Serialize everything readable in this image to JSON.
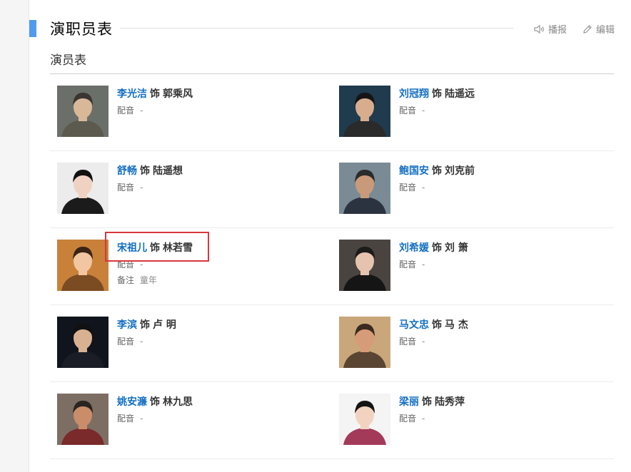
{
  "section": {
    "title": "演职员表",
    "tools": {
      "report": "播报",
      "edit": "编辑"
    }
  },
  "subheading": "演员表",
  "role_joiner": "饰",
  "dub_label": "配音",
  "note_label": "备注",
  "cast": [
    {
      "actor": "李光洁",
      "role": "郭乘风",
      "dub": "-",
      "note": null
    },
    {
      "actor": "刘冠翔",
      "role": "陆遥远",
      "dub": "-",
      "note": null
    },
    {
      "actor": "舒畅",
      "role": "陆遥想",
      "dub": "-",
      "note": null
    },
    {
      "actor": "鲍国安",
      "role": "刘克前",
      "dub": "-",
      "note": null
    },
    {
      "actor": "宋祖儿",
      "role": "林若雪",
      "dub": "-",
      "note": "童年"
    },
    {
      "actor": "刘希媛",
      "role": "刘 箫",
      "dub": "-",
      "note": null
    },
    {
      "actor": "李滨",
      "role": "卢 明",
      "dub": "-",
      "note": null
    },
    {
      "actor": "马文忠",
      "role": "马 杰",
      "dub": "-",
      "note": null
    },
    {
      "actor": "姚安濂",
      "role": "林九思",
      "dub": "-",
      "note": null
    },
    {
      "actor": "梁丽",
      "role": "陆秀萍",
      "dub": "-",
      "note": null
    }
  ],
  "colors": {
    "accent": "#4f9cee",
    "link": "#136ec2",
    "highlight": "#d9363e"
  }
}
